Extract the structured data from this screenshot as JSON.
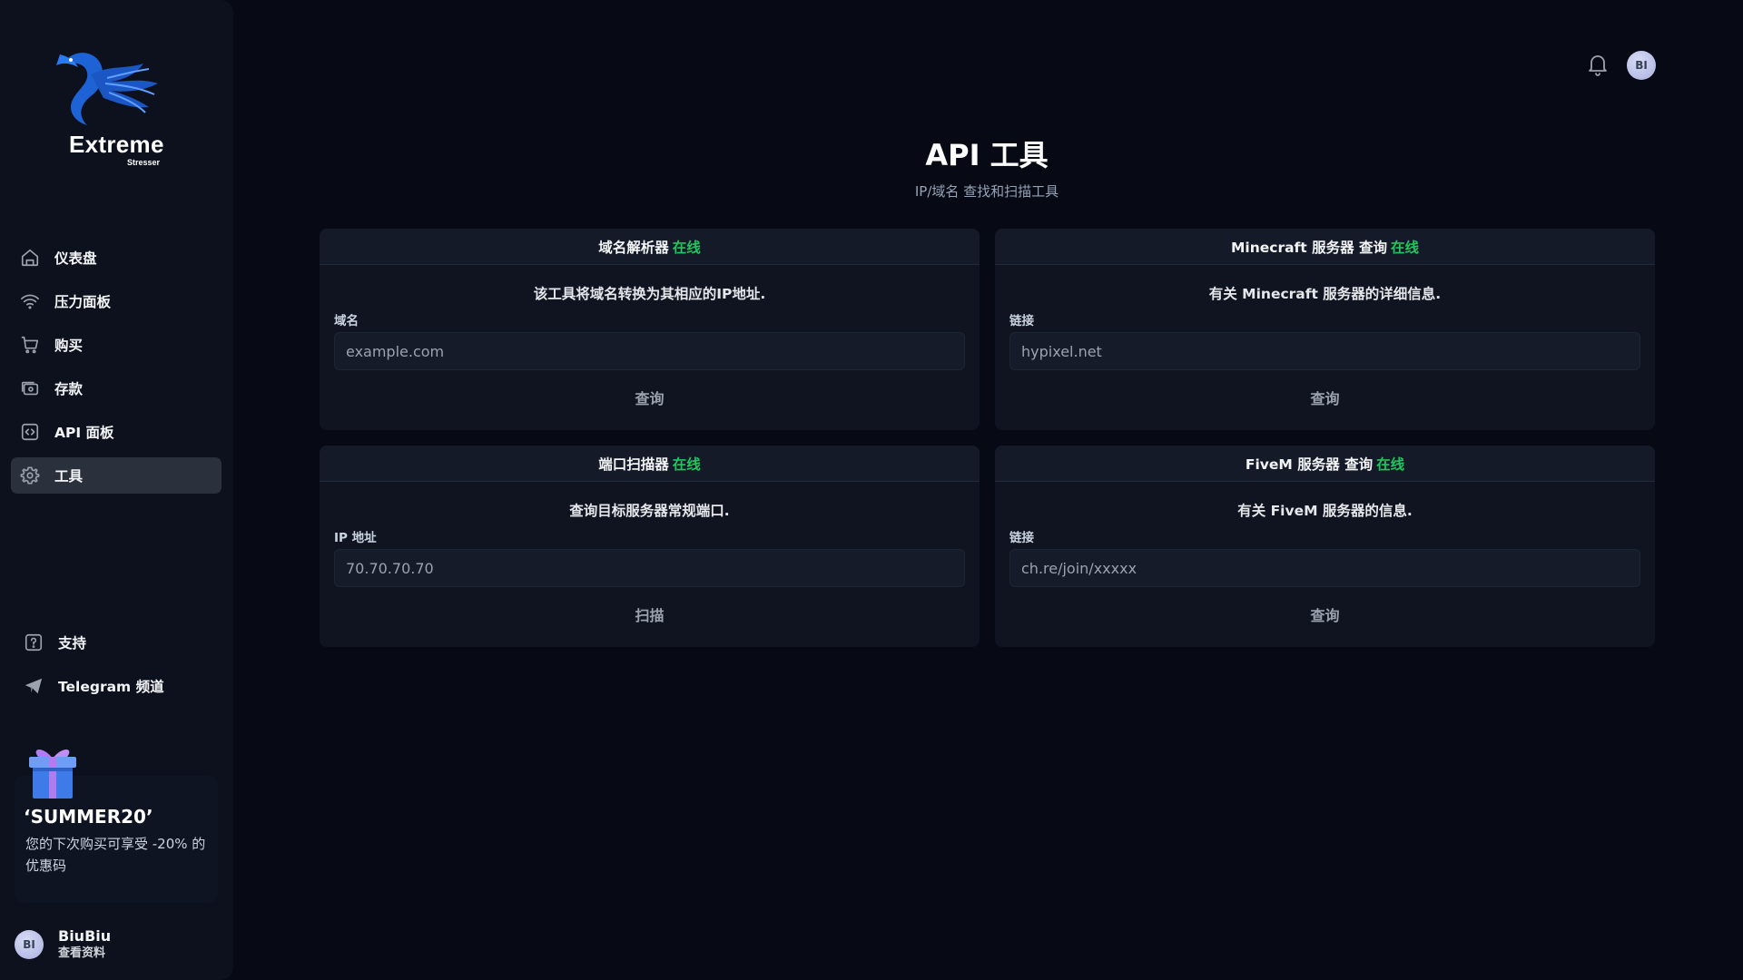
{
  "brand": {
    "name": "Extreme",
    "sub": "Stresser"
  },
  "sidebar": {
    "items": [
      {
        "label": "仪表盘",
        "icon": "home-icon"
      },
      {
        "label": "压力面板",
        "icon": "wifi-icon"
      },
      {
        "label": "购买",
        "icon": "cart-icon"
      },
      {
        "label": "存款",
        "icon": "wallet-icon"
      },
      {
        "label": "API 面板",
        "icon": "code-icon"
      },
      {
        "label": "工具",
        "icon": "gear-icon",
        "active": true
      }
    ],
    "bottom": [
      {
        "label": "支持",
        "icon": "help-icon"
      },
      {
        "label": "Telegram 频道",
        "icon": "send-icon"
      }
    ]
  },
  "promo": {
    "code": "‘SUMMER20’",
    "text": "您的下次购买可享受 -20% 的优惠码"
  },
  "profile": {
    "initials": "BI",
    "name": "BiuBiu",
    "link": "查看资料"
  },
  "header": {
    "avatar_initials": "BI"
  },
  "page": {
    "title": "API 工具",
    "subtitle": "IP/域名 查找和扫描工具"
  },
  "cards": [
    {
      "title": "域名解析器",
      "status": "在线",
      "desc": "该工具将域名转换为其相应的IP地址.",
      "label": "域名",
      "placeholder": "example.com",
      "button": "查询"
    },
    {
      "title": "Minecraft 服务器 查询",
      "status": "在线",
      "desc": "有关 Minecraft 服务器的详细信息.",
      "label": "链接",
      "placeholder": "hypixel.net",
      "button": "查询"
    },
    {
      "title": "端口扫描器",
      "status": "在线",
      "desc": "查询目标服务器常规端口.",
      "label": "IP 地址",
      "placeholder": "70.70.70.70",
      "button": "扫描"
    },
    {
      "title": "FiveM 服务器 查询",
      "status": "在线",
      "desc": "有关 FiveM 服务器的信息.",
      "label": "链接",
      "placeholder": "ch.re/join/xxxxx",
      "button": "查询"
    }
  ],
  "colors": {
    "accent_online": "#22c55e",
    "background": "#070a14",
    "sidebar": "#0c111d",
    "card": "#0f1420"
  }
}
